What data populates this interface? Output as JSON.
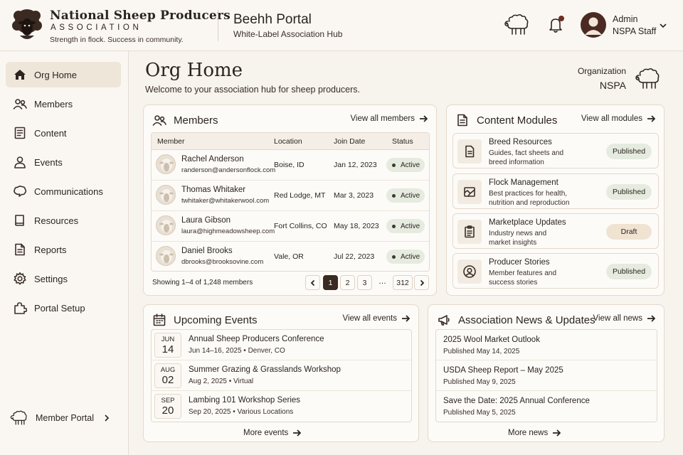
{
  "header": {
    "brand_title": "National Sheep Producers",
    "brand_sub": "ASSOCIATION",
    "brand_tagline": "Strength in flock. Success in community.",
    "portal_title": "Beehh Portal",
    "portal_sub": "White-Label Association Hub",
    "user_name": "Admin",
    "user_role": "NSPA Staff"
  },
  "sidebar": {
    "items": [
      {
        "label": "Org Home",
        "icon": "home-icon"
      },
      {
        "label": "Members",
        "icon": "users-icon"
      },
      {
        "label": "Content",
        "icon": "document-icon"
      },
      {
        "label": "Events",
        "icon": "person-icon"
      },
      {
        "label": "Communications",
        "icon": "chat-icon"
      },
      {
        "label": "Resources",
        "icon": "book-icon"
      },
      {
        "label": "Reports",
        "icon": "report-icon"
      },
      {
        "label": "Settings",
        "icon": "gear-icon"
      },
      {
        "label": "Portal Setup",
        "icon": "puzzle-icon"
      }
    ],
    "member_portal": "Member Portal"
  },
  "page": {
    "title": "Org Home",
    "subtitle": "Welcome to your association hub for sheep producers.",
    "org_label": "Organization",
    "org_value": "NSPA"
  },
  "members": {
    "title": "Members",
    "view_all": "View all members",
    "columns": [
      "Member",
      "Location",
      "Join Date",
      "Status"
    ],
    "rows": [
      {
        "name": "Rachel Anderson",
        "email": "randerson@andersonflock.com",
        "location": "Boise, ID",
        "date": "Jan 12, 2023",
        "status": "Active"
      },
      {
        "name": "Thomas Whitaker",
        "email": "twhitaker@whitakerwool.com",
        "location": "Red Lodge, MT",
        "date": "Mar 3, 2023",
        "status": "Active"
      },
      {
        "name": "Laura Gibson",
        "email": "laura@highmeadowsheep.com",
        "location": "Fort Collins, CO",
        "date": "May 18, 2023",
        "status": "Active"
      },
      {
        "name": "Daniel Brooks",
        "email": "dbrooks@brooksovine.com",
        "location": "Vale, OR",
        "date": "Jul 22, 2023",
        "status": "Active"
      }
    ],
    "showing": "Showing 1–4 of 1,248 members",
    "pages": [
      "1",
      "2",
      "3",
      "…",
      "312"
    ]
  },
  "modules": {
    "title": "Content Modules",
    "view_all": "View all modules",
    "items": [
      {
        "title": "Breed Resources",
        "desc": "Guides, fact sheets and breed information",
        "status": "Published"
      },
      {
        "title": "Flock Management",
        "desc": "Best practices for health, nutrition and reproduction",
        "status": "Published"
      },
      {
        "title": "Marketplace Updates",
        "desc": "Industry news and market insights",
        "status": "Draft"
      },
      {
        "title": "Producer Stories",
        "desc": "Member features and success stories",
        "status": "Published"
      }
    ]
  },
  "events": {
    "title": "Upcoming Events",
    "view_all": "View all events",
    "items": [
      {
        "month": "JUN",
        "day": "14",
        "title": "Annual Sheep Producers Conference",
        "meta": "Jun 14–16, 2025  •  Denver, CO"
      },
      {
        "month": "AUG",
        "day": "02",
        "title": "Summer Grazing & Grasslands Workshop",
        "meta": "Aug 2, 2025  •  Virtual"
      },
      {
        "month": "SEP",
        "day": "20",
        "title": "Lambing 101 Workshop Series",
        "meta": "Sep 20, 2025  •  Various Locations"
      }
    ],
    "more": "More events"
  },
  "news": {
    "title": "Association News & Updates",
    "view_all": "View all news",
    "items": [
      {
        "title": "2025 Wool Market Outlook",
        "date": "Published May 14, 2025"
      },
      {
        "title": "USDA Sheep Report – May 2025",
        "date": "Published May 9, 2025"
      },
      {
        "title": "Save the Date: 2025 Annual Conference",
        "date": "Published May 5, 2025"
      }
    ],
    "more": "More news"
  }
}
